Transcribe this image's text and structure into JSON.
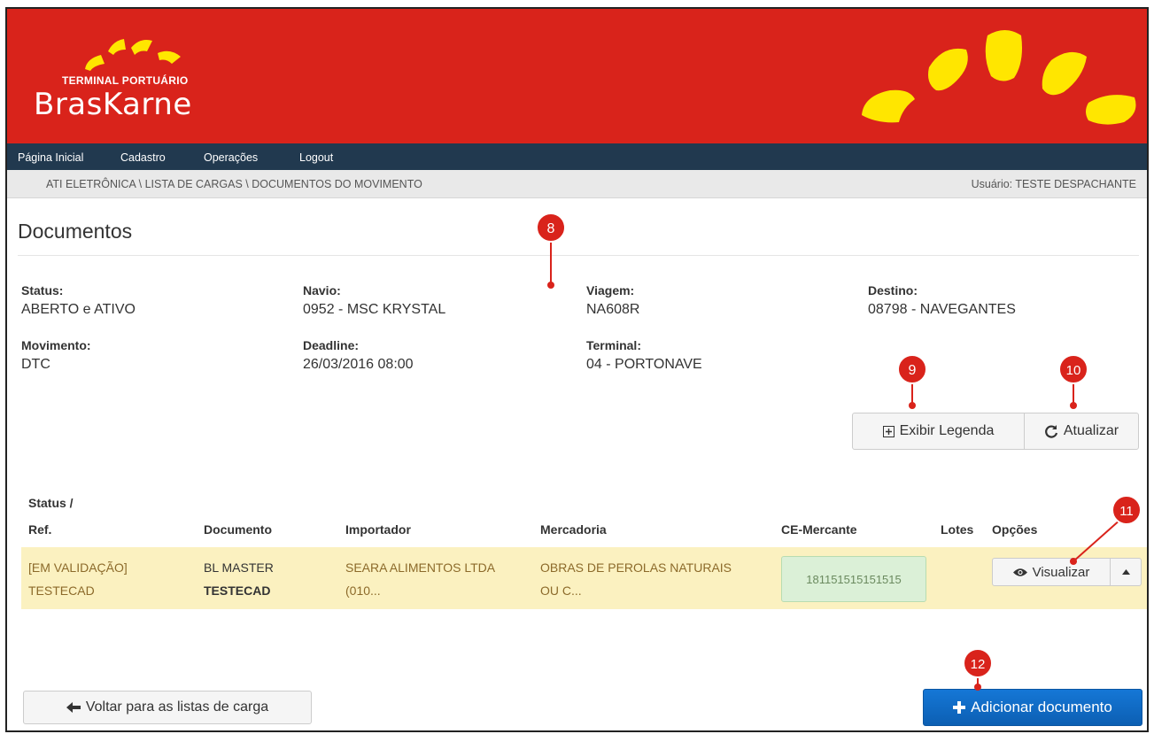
{
  "brand": {
    "logo_subtitle": "TERMINAL PORTUÁRIO",
    "logo_name": "BrasKarne",
    "banner_color": "#d9231b",
    "sun_color": "#ffe600"
  },
  "nav": {
    "items": [
      "Página Inicial",
      "Cadastro",
      "Operações",
      "Logout"
    ]
  },
  "breadcrumb": {
    "path": "ATI ELETRÔNICA \\ LISTA DE CARGAS \\ DOCUMENTOS DO MOVIMENTO",
    "user": "Usuário: TESTE DESPACHANTE"
  },
  "page": {
    "title": "Documentos"
  },
  "details": {
    "status_label": "Status:",
    "status_value": "ABERTO e ATIVO",
    "navio_label": "Navio:",
    "navio_value": "0952 - MSC KRYSTAL",
    "viagem_label": "Viagem:",
    "viagem_value": "NA608R",
    "destino_label": "Destino:",
    "destino_value": "08798 - NAVEGANTES",
    "movimento_label": "Movimento:",
    "movimento_value": "DTC",
    "deadline_label": "Deadline:",
    "deadline_value": "26/03/2016 08:00",
    "terminal_label": "Terminal:",
    "terminal_value": "04 - PORTONAVE"
  },
  "actions": {
    "legend_icon": "plus-square-icon",
    "legend_label": "Exibir Legenda",
    "refresh_icon": "refresh-icon",
    "refresh_label": "Atualizar",
    "back_icon": "arrow-left-icon",
    "back_label": "Voltar para as listas de carga",
    "add_icon": "plus-icon",
    "add_label": "Adicionar documento"
  },
  "table": {
    "headers": {
      "status_line1": "Status /",
      "status_line2": "Ref.",
      "documento": "Documento",
      "importador": "Importador",
      "mercadoria": "Mercadoria",
      "ce_mercante": "CE-Mercante",
      "lotes": "Lotes",
      "opcoes": "Opções"
    },
    "rows": [
      {
        "status": "[EM VALIDAÇÃO]",
        "ref": "TESTECAD",
        "documento_type": "BL MASTER",
        "documento_ref": "TESTECAD",
        "importador_line1": "SEARA ALIMENTOS LTDA",
        "importador_line2": "(010...",
        "mercadoria_line1": "OBRAS DE PEROLAS NATURAIS",
        "mercadoria_line2": "OU C...",
        "ce_mercante": "181151515151515",
        "lotes": "",
        "view_icon": "eye-icon",
        "view_label": "Visualizar",
        "dropdown_icon": "caret-up-icon",
        "row_color": "#fbf1c0"
      }
    ]
  },
  "annotations": {
    "marker_color": "#d9231b",
    "markers": [
      "8",
      "9",
      "10",
      "11",
      "12"
    ]
  }
}
